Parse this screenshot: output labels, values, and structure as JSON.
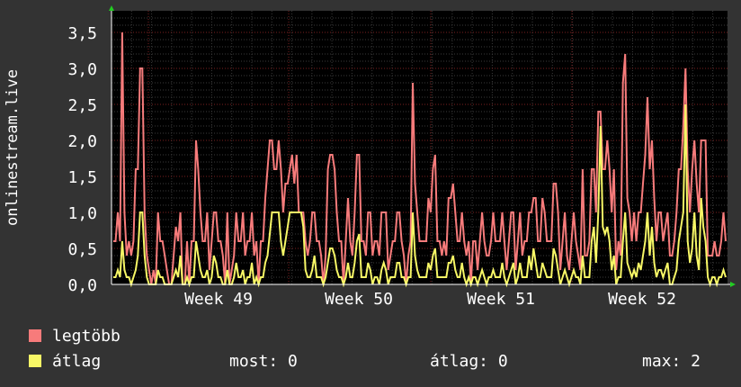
{
  "chart_data": {
    "type": "line",
    "ylabel": "onlinestream.live",
    "ylim": [
      0,
      3.8
    ],
    "yticks": [
      "0,0",
      "0,5",
      "1,0",
      "1,5",
      "2,0",
      "2,5",
      "3,0",
      "3,5"
    ],
    "xticks": [
      "Week 49",
      "Week 50",
      "Week 51",
      "Week 52"
    ],
    "grid": true,
    "background": "#000000",
    "series": [
      {
        "name": "legtöbb",
        "color": "#f77b7b",
        "values": [
          0.6,
          0.6,
          1.0,
          0.6,
          3.5,
          1.0,
          0.4,
          0.6,
          0.4,
          0.6,
          1.6,
          1.6,
          3.0,
          3.0,
          1.0,
          0.4,
          0.2,
          0.0,
          0.2,
          0.0,
          1.0,
          0.6,
          0.6,
          0.4,
          0.2,
          0.0,
          0.0,
          0.4,
          0.8,
          0.6,
          1.0,
          0.0,
          0.0,
          0.6,
          0.0,
          0.6,
          0.6,
          2.0,
          1.6,
          1.0,
          0.6,
          0.6,
          1.0,
          0.2,
          0.6,
          1.0,
          1.0,
          0.6,
          0.6,
          0.4,
          0.0,
          1.0,
          0.0,
          0.2,
          0.4,
          1.0,
          0.6,
          0.6,
          1.0,
          0.4,
          0.6,
          0.6,
          1.0,
          0.4,
          0.6,
          0.0,
          0.6,
          0.6,
          1.2,
          1.6,
          2.0,
          2.0,
          1.6,
          1.6,
          2.0,
          1.6,
          1.0,
          1.4,
          1.4,
          1.6,
          1.8,
          1.4,
          1.8,
          1.0,
          1.0,
          1.0,
          0.6,
          0.4,
          0.6,
          1.0,
          1.0,
          0.6,
          0.6,
          0.4,
          0.0,
          0.4,
          1.6,
          1.8,
          1.8,
          1.6,
          1.0,
          0.6,
          0.6,
          0.0,
          0.6,
          1.2,
          0.6,
          0.4,
          1.0,
          1.8,
          1.8,
          0.6,
          0.6,
          0.4,
          1.0,
          1.0,
          0.4,
          0.6,
          0.6,
          0.4,
          1.0,
          1.0,
          1.0,
          0.2,
          0.4,
          0.6,
          0.6,
          1.0,
          1.0,
          0.6,
          0.4,
          0.0,
          0.4,
          0.6,
          2.8,
          1.4,
          1.0,
          0.6,
          0.6,
          0.6,
          0.6,
          1.2,
          1.0,
          1.6,
          1.8,
          0.6,
          0.6,
          0.4,
          0.6,
          0.4,
          1.2,
          1.2,
          1.4,
          1.0,
          0.6,
          0.6,
          1.0,
          0.6,
          0.4,
          0.6,
          0.0,
          0.6,
          0.6,
          0.2,
          0.6,
          1.0,
          0.6,
          0.4,
          0.4,
          0.6,
          1.0,
          0.6,
          0.6,
          0.6,
          1.0,
          0.6,
          0.2,
          0.6,
          1.0,
          1.0,
          0.2,
          0.6,
          1.0,
          0.4,
          0.6,
          0.6,
          1.0,
          1.0,
          1.2,
          1.2,
          0.6,
          0.6,
          1.2,
          1.0,
          0.6,
          0.6,
          0.6,
          1.4,
          1.4,
          1.0,
          0.2,
          0.6,
          1.0,
          0.4,
          0.2,
          0.6,
          1.0,
          0.6,
          0.4,
          0.2,
          1.6,
          0.4,
          0.4,
          0.6,
          1.6,
          1.6,
          1.0,
          2.4,
          2.4,
          1.6,
          1.6,
          2.0,
          1.6,
          1.0,
          1.6,
          0.2,
          0.6,
          0.4,
          2.8,
          3.2,
          1.2,
          1.0,
          0.6,
          1.0,
          0.6,
          1.0,
          1.0,
          1.4,
          1.8,
          2.6,
          1.6,
          2.0,
          1.2,
          0.6,
          1.0,
          1.0,
          0.6,
          0.8,
          1.0,
          0.4,
          0.4,
          0.6,
          1.0,
          1.6,
          1.6,
          2.2,
          3.0,
          1.6,
          1.0,
          1.6,
          2.0,
          1.4,
          1.0,
          2.0,
          2.0,
          2.0,
          0.4,
          0.4,
          0.4,
          0.6,
          0.4,
          0.4,
          0.6,
          1.0,
          0.6
        ]
      },
      {
        "name": "átlag",
        "color": "#f7f766",
        "values": [
          0.1,
          0.1,
          0.2,
          0.1,
          0.6,
          0.2,
          0.1,
          0.1,
          0.0,
          0.1,
          0.2,
          0.4,
          1.0,
          1.0,
          0.4,
          0.1,
          0.0,
          0.0,
          0.0,
          0.0,
          0.2,
          0.1,
          0.1,
          0.0,
          0.0,
          0.0,
          0.0,
          0.1,
          0.2,
          0.1,
          0.4,
          0.0,
          0.0,
          0.1,
          0.0,
          0.1,
          0.1,
          0.6,
          0.4,
          0.2,
          0.1,
          0.1,
          0.2,
          0.0,
          0.1,
          0.4,
          0.3,
          0.1,
          0.1,
          0.0,
          0.0,
          0.2,
          0.0,
          0.0,
          0.1,
          0.3,
          0.1,
          0.1,
          0.2,
          0.0,
          0.1,
          0.1,
          0.3,
          0.0,
          0.1,
          0.0,
          0.1,
          0.1,
          0.3,
          0.4,
          0.7,
          1.0,
          1.0,
          1.0,
          1.0,
          0.6,
          0.4,
          0.6,
          0.8,
          1.0,
          1.0,
          1.0,
          1.0,
          1.0,
          1.0,
          0.8,
          0.2,
          0.1,
          0.1,
          0.2,
          0.4,
          0.1,
          0.1,
          0.1,
          0.0,
          0.1,
          0.3,
          0.5,
          0.5,
          0.4,
          0.2,
          0.1,
          0.1,
          0.0,
          0.1,
          0.3,
          0.1,
          0.1,
          0.3,
          0.6,
          0.7,
          0.1,
          0.1,
          0.1,
          0.3,
          0.2,
          0.0,
          0.1,
          0.1,
          0.0,
          0.2,
          0.3,
          0.2,
          0.0,
          0.1,
          0.1,
          0.1,
          0.3,
          0.3,
          0.1,
          0.1,
          0.0,
          0.1,
          0.1,
          1.0,
          0.4,
          0.2,
          0.1,
          0.1,
          0.1,
          0.1,
          0.3,
          0.2,
          0.4,
          0.5,
          0.1,
          0.1,
          0.1,
          0.1,
          0.1,
          0.3,
          0.3,
          0.4,
          0.2,
          0.1,
          0.1,
          0.3,
          0.1,
          0.0,
          0.1,
          0.0,
          0.1,
          0.1,
          0.0,
          0.1,
          0.2,
          0.1,
          0.0,
          0.1,
          0.1,
          0.2,
          0.1,
          0.1,
          0.1,
          0.3,
          0.1,
          0.0,
          0.1,
          0.2,
          0.3,
          0.0,
          0.1,
          0.3,
          0.1,
          0.1,
          0.1,
          0.4,
          0.2,
          0.5,
          0.3,
          0.1,
          0.1,
          0.3,
          0.2,
          0.1,
          0.1,
          0.1,
          0.5,
          0.4,
          0.2,
          0.0,
          0.1,
          0.2,
          0.1,
          0.0,
          0.1,
          0.2,
          0.1,
          0.1,
          0.0,
          0.4,
          0.1,
          0.1,
          0.1,
          0.6,
          0.8,
          0.3,
          1.0,
          2.2,
          0.8,
          0.7,
          0.8,
          0.6,
          0.2,
          0.4,
          0.0,
          0.1,
          0.1,
          0.6,
          1.0,
          0.3,
          0.2,
          0.1,
          0.2,
          0.1,
          0.3,
          0.2,
          0.4,
          0.6,
          1.0,
          0.4,
          0.8,
          0.3,
          0.1,
          0.2,
          0.2,
          0.1,
          0.2,
          0.3,
          0.0,
          0.0,
          0.1,
          0.2,
          0.6,
          0.8,
          1.0,
          2.5,
          0.6,
          0.3,
          0.5,
          1.0,
          0.4,
          0.2,
          1.2,
          0.8,
          0.6,
          0.1,
          0.0,
          0.1,
          0.1,
          0.0,
          0.1,
          0.1,
          0.2,
          0.1
        ]
      }
    ]
  },
  "legend": [
    {
      "label": "legtöbb",
      "color": "#f77b7b"
    },
    {
      "label": "átlag",
      "color": "#f7f766"
    }
  ],
  "stats": {
    "most": "most: 0",
    "atlag": "átlag: 0",
    "max": "max: 2"
  }
}
